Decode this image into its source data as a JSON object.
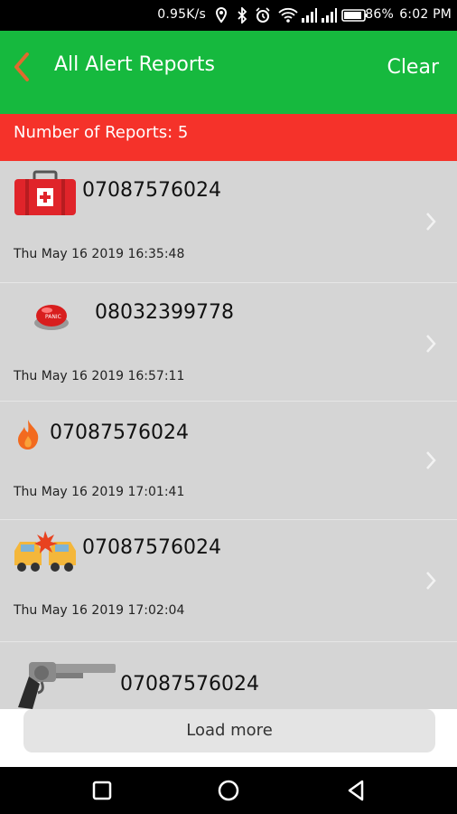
{
  "status_bar": {
    "text": "0.95K/s  ⌖  ✱  ⏰  ≋ ₊ıl ₊ıl ▭86%  6:02 PM",
    "speed": "0.95K/s",
    "battery": "86%",
    "time": "6:02 PM"
  },
  "app_bar": {
    "title": "All Alert Reports",
    "clear_label": "Clear",
    "back_icon": "chevron-left-icon",
    "color": "#16b93e"
  },
  "count_bar": {
    "text": "Number of Reports: 5",
    "color": "#f5322a"
  },
  "reports": [
    {
      "phone": "07087576024",
      "time": "Thu May 16 2019 16:35:48",
      "icon": "first-aid-kit-icon"
    },
    {
      "phone": "08032399778",
      "time": "Thu May 16 2019 16:57:11",
      "icon": "panic-button-icon"
    },
    {
      "phone": "07087576024",
      "time": "Thu May 16 2019 17:01:41",
      "icon": "fire-icon"
    },
    {
      "phone": "07087576024",
      "time": "Thu May 16 2019 17:02:04",
      "icon": "car-crash-icon"
    },
    {
      "phone": "07087576024",
      "time": "",
      "icon": "revolver-icon"
    }
  ],
  "load_more_label": "Load more",
  "nav": {
    "recents": "square-icon",
    "home": "circle-icon",
    "back": "triangle-back-icon"
  }
}
